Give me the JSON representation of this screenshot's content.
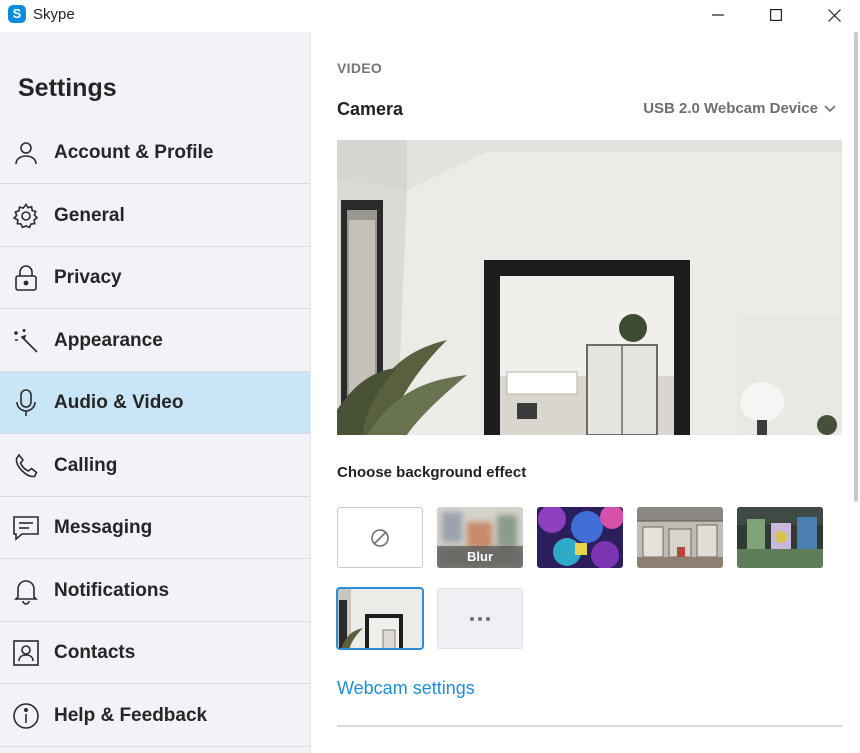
{
  "window": {
    "app_name": "Skype",
    "logo_letter": "S"
  },
  "sidebar": {
    "title": "Settings",
    "items": [
      {
        "label": "Account & Profile",
        "icon": "person-icon"
      },
      {
        "label": "General",
        "icon": "gear-icon"
      },
      {
        "label": "Privacy",
        "icon": "lock-icon"
      },
      {
        "label": "Appearance",
        "icon": "magic-wand-icon"
      },
      {
        "label": "Audio & Video",
        "icon": "microphone-icon",
        "active": true
      },
      {
        "label": "Calling",
        "icon": "phone-icon"
      },
      {
        "label": "Messaging",
        "icon": "chat-bubble-icon"
      },
      {
        "label": "Notifications",
        "icon": "bell-icon"
      },
      {
        "label": "Contacts",
        "icon": "contact-card-icon"
      },
      {
        "label": "Help & Feedback",
        "icon": "info-icon"
      }
    ]
  },
  "main": {
    "section": "VIDEO",
    "camera_label": "Camera",
    "camera_device": "USB 2.0 Webcam Device",
    "background_effect_label": "Choose background effect",
    "effects": [
      {
        "name": "none",
        "icon": "no-effect-icon"
      },
      {
        "name": "blur",
        "label": "Blur"
      },
      {
        "name": "image-colorful"
      },
      {
        "name": "image-office"
      },
      {
        "name": "image-room"
      },
      {
        "name": "image-custom",
        "selected": true
      },
      {
        "name": "more",
        "icon": "more-dots-icon"
      }
    ],
    "webcam_settings_link": "Webcam settings"
  },
  "colors": {
    "accent": "#1d8fd7",
    "active_nav": "#c8e6f8",
    "sidebar_bg": "#f1f3f9"
  }
}
